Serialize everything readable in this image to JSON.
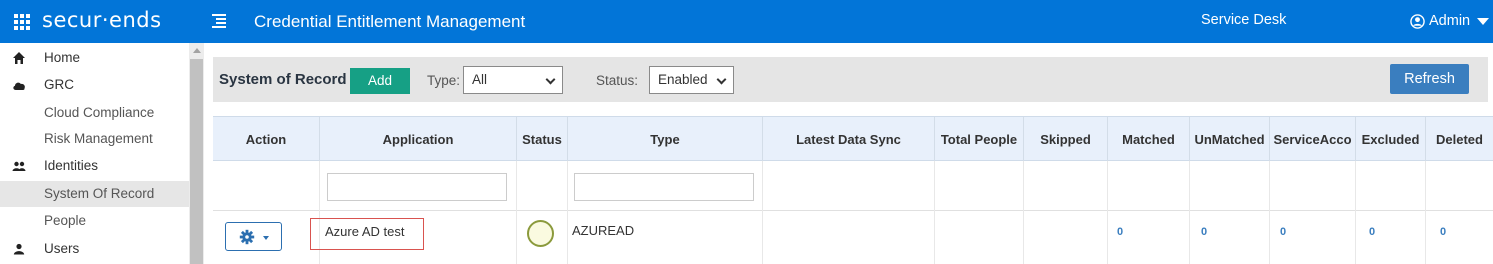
{
  "header": {
    "logo": "secur·ends",
    "title": "Credential Entitlement Management",
    "service_desk": "Service Desk",
    "user": "Admin"
  },
  "sidebar": {
    "items": [
      {
        "label": "Home",
        "icon": "home-icon"
      },
      {
        "label": "GRC",
        "icon": "cloud-icon"
      },
      {
        "label": "Cloud Compliance"
      },
      {
        "label": "Risk Management"
      },
      {
        "label": "Identities",
        "icon": "users-icon"
      },
      {
        "label": "System Of Record",
        "active": true
      },
      {
        "label": "People"
      },
      {
        "label": "Users",
        "icon": "user-icon"
      }
    ]
  },
  "toolbar": {
    "title": "System of Record",
    "add_label": "Add",
    "type_label": "Type:",
    "type_value": "All",
    "status_label": "Status:",
    "status_value": "Enabled",
    "refresh_label": "Refresh"
  },
  "table": {
    "columns": [
      "Action",
      "Application",
      "Status",
      "Type",
      "Latest Data Sync",
      "Total People",
      "Skipped",
      "Matched",
      "UnMatched",
      "ServiceAcco",
      "Excluded",
      "Deleted"
    ],
    "rows": [
      {
        "application": "Azure AD test",
        "type": "AZUREAD",
        "latest_data_sync": "",
        "total_people": "",
        "skipped": "",
        "matched": "0",
        "unmatched": "0",
        "service_accounts": "0",
        "excluded": "0",
        "deleted": "0"
      }
    ]
  },
  "colors": {
    "topbar": "#0275d8",
    "add_button": "#16a085",
    "refresh_button": "#3a7ebf",
    "highlight_border": "#d9534f"
  }
}
